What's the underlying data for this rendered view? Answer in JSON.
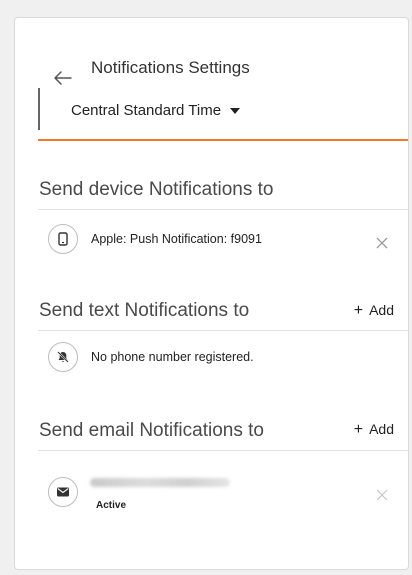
{
  "header": {
    "title": "Notifications Settings",
    "timezone": "Central Standard Time"
  },
  "device_section": {
    "title": "Send device Notifications to",
    "items": [
      {
        "label": "Apple: Push Notification: f9091"
      }
    ]
  },
  "text_section": {
    "title": "Send text Notifications to",
    "add_label": "Add",
    "empty_text": "No phone number registered."
  },
  "email_section": {
    "title": "Send email Notifications to",
    "add_label": "Add",
    "items": [
      {
        "status": "Active"
      }
    ]
  },
  "colors": {
    "accent": "#f07a2a",
    "text": "#222222",
    "muted": "#4a4a4a"
  }
}
